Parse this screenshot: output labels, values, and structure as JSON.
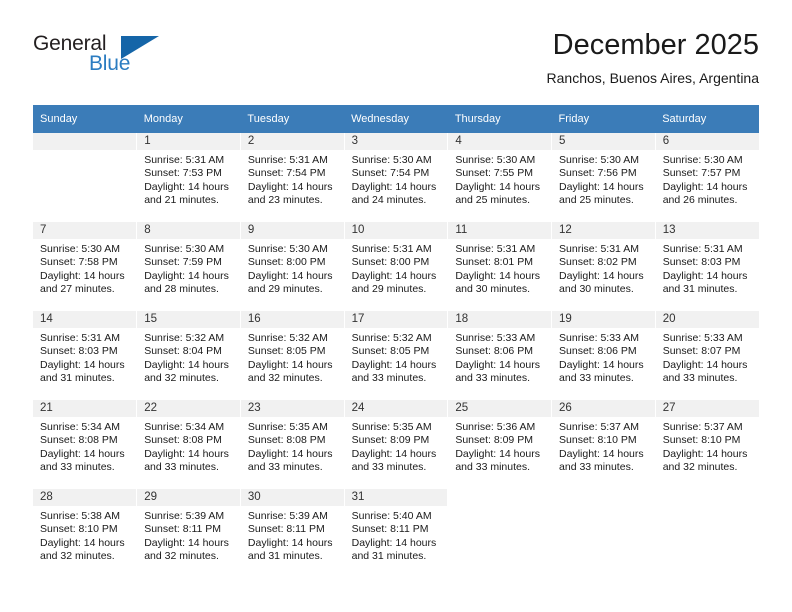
{
  "logo": {
    "line1": "General",
    "line2": "Blue",
    "triangle_color": "#1565a8",
    "blue_color": "#2b7cc1",
    "dark_color": "#231f20"
  },
  "header": {
    "title": "December 2025",
    "location": "Ranchos, Buenos Aires, Argentina"
  },
  "theme": {
    "header_bg": "#3b7cb8",
    "daynum_bg": "#f1f1f1",
    "text": "#1a1a1a"
  },
  "weekdays": [
    "Sunday",
    "Monday",
    "Tuesday",
    "Wednesday",
    "Thursday",
    "Friday",
    "Saturday"
  ],
  "labels": {
    "sunrise_prefix": "Sunrise:",
    "sunset_prefix": "Sunset:",
    "daylight_prefix": "Daylight:"
  },
  "weeks": [
    [
      {
        "day": "",
        "sunrise": "",
        "sunset": "",
        "daylight1": "",
        "daylight2": ""
      },
      {
        "day": "1",
        "sunrise": "Sunrise: 5:31 AM",
        "sunset": "Sunset: 7:53 PM",
        "daylight1": "Daylight: 14 hours",
        "daylight2": "and 21 minutes."
      },
      {
        "day": "2",
        "sunrise": "Sunrise: 5:31 AM",
        "sunset": "Sunset: 7:54 PM",
        "daylight1": "Daylight: 14 hours",
        "daylight2": "and 23 minutes."
      },
      {
        "day": "3",
        "sunrise": "Sunrise: 5:30 AM",
        "sunset": "Sunset: 7:54 PM",
        "daylight1": "Daylight: 14 hours",
        "daylight2": "and 24 minutes."
      },
      {
        "day": "4",
        "sunrise": "Sunrise: 5:30 AM",
        "sunset": "Sunset: 7:55 PM",
        "daylight1": "Daylight: 14 hours",
        "daylight2": "and 25 minutes."
      },
      {
        "day": "5",
        "sunrise": "Sunrise: 5:30 AM",
        "sunset": "Sunset: 7:56 PM",
        "daylight1": "Daylight: 14 hours",
        "daylight2": "and 25 minutes."
      },
      {
        "day": "6",
        "sunrise": "Sunrise: 5:30 AM",
        "sunset": "Sunset: 7:57 PM",
        "daylight1": "Daylight: 14 hours",
        "daylight2": "and 26 minutes."
      }
    ],
    [
      {
        "day": "7",
        "sunrise": "Sunrise: 5:30 AM",
        "sunset": "Sunset: 7:58 PM",
        "daylight1": "Daylight: 14 hours",
        "daylight2": "and 27 minutes."
      },
      {
        "day": "8",
        "sunrise": "Sunrise: 5:30 AM",
        "sunset": "Sunset: 7:59 PM",
        "daylight1": "Daylight: 14 hours",
        "daylight2": "and 28 minutes."
      },
      {
        "day": "9",
        "sunrise": "Sunrise: 5:30 AM",
        "sunset": "Sunset: 8:00 PM",
        "daylight1": "Daylight: 14 hours",
        "daylight2": "and 29 minutes."
      },
      {
        "day": "10",
        "sunrise": "Sunrise: 5:31 AM",
        "sunset": "Sunset: 8:00 PM",
        "daylight1": "Daylight: 14 hours",
        "daylight2": "and 29 minutes."
      },
      {
        "day": "11",
        "sunrise": "Sunrise: 5:31 AM",
        "sunset": "Sunset: 8:01 PM",
        "daylight1": "Daylight: 14 hours",
        "daylight2": "and 30 minutes."
      },
      {
        "day": "12",
        "sunrise": "Sunrise: 5:31 AM",
        "sunset": "Sunset: 8:02 PM",
        "daylight1": "Daylight: 14 hours",
        "daylight2": "and 30 minutes."
      },
      {
        "day": "13",
        "sunrise": "Sunrise: 5:31 AM",
        "sunset": "Sunset: 8:03 PM",
        "daylight1": "Daylight: 14 hours",
        "daylight2": "and 31 minutes."
      }
    ],
    [
      {
        "day": "14",
        "sunrise": "Sunrise: 5:31 AM",
        "sunset": "Sunset: 8:03 PM",
        "daylight1": "Daylight: 14 hours",
        "daylight2": "and 31 minutes."
      },
      {
        "day": "15",
        "sunrise": "Sunrise: 5:32 AM",
        "sunset": "Sunset: 8:04 PM",
        "daylight1": "Daylight: 14 hours",
        "daylight2": "and 32 minutes."
      },
      {
        "day": "16",
        "sunrise": "Sunrise: 5:32 AM",
        "sunset": "Sunset: 8:05 PM",
        "daylight1": "Daylight: 14 hours",
        "daylight2": "and 32 minutes."
      },
      {
        "day": "17",
        "sunrise": "Sunrise: 5:32 AM",
        "sunset": "Sunset: 8:05 PM",
        "daylight1": "Daylight: 14 hours",
        "daylight2": "and 33 minutes."
      },
      {
        "day": "18",
        "sunrise": "Sunrise: 5:33 AM",
        "sunset": "Sunset: 8:06 PM",
        "daylight1": "Daylight: 14 hours",
        "daylight2": "and 33 minutes."
      },
      {
        "day": "19",
        "sunrise": "Sunrise: 5:33 AM",
        "sunset": "Sunset: 8:06 PM",
        "daylight1": "Daylight: 14 hours",
        "daylight2": "and 33 minutes."
      },
      {
        "day": "20",
        "sunrise": "Sunrise: 5:33 AM",
        "sunset": "Sunset: 8:07 PM",
        "daylight1": "Daylight: 14 hours",
        "daylight2": "and 33 minutes."
      }
    ],
    [
      {
        "day": "21",
        "sunrise": "Sunrise: 5:34 AM",
        "sunset": "Sunset: 8:08 PM",
        "daylight1": "Daylight: 14 hours",
        "daylight2": "and 33 minutes."
      },
      {
        "day": "22",
        "sunrise": "Sunrise: 5:34 AM",
        "sunset": "Sunset: 8:08 PM",
        "daylight1": "Daylight: 14 hours",
        "daylight2": "and 33 minutes."
      },
      {
        "day": "23",
        "sunrise": "Sunrise: 5:35 AM",
        "sunset": "Sunset: 8:08 PM",
        "daylight1": "Daylight: 14 hours",
        "daylight2": "and 33 minutes."
      },
      {
        "day": "24",
        "sunrise": "Sunrise: 5:35 AM",
        "sunset": "Sunset: 8:09 PM",
        "daylight1": "Daylight: 14 hours",
        "daylight2": "and 33 minutes."
      },
      {
        "day": "25",
        "sunrise": "Sunrise: 5:36 AM",
        "sunset": "Sunset: 8:09 PM",
        "daylight1": "Daylight: 14 hours",
        "daylight2": "and 33 minutes."
      },
      {
        "day": "26",
        "sunrise": "Sunrise: 5:37 AM",
        "sunset": "Sunset: 8:10 PM",
        "daylight1": "Daylight: 14 hours",
        "daylight2": "and 33 minutes."
      },
      {
        "day": "27",
        "sunrise": "Sunrise: 5:37 AM",
        "sunset": "Sunset: 8:10 PM",
        "daylight1": "Daylight: 14 hours",
        "daylight2": "and 32 minutes."
      }
    ],
    [
      {
        "day": "28",
        "sunrise": "Sunrise: 5:38 AM",
        "sunset": "Sunset: 8:10 PM",
        "daylight1": "Daylight: 14 hours",
        "daylight2": "and 32 minutes."
      },
      {
        "day": "29",
        "sunrise": "Sunrise: 5:39 AM",
        "sunset": "Sunset: 8:11 PM",
        "daylight1": "Daylight: 14 hours",
        "daylight2": "and 32 minutes."
      },
      {
        "day": "30",
        "sunrise": "Sunrise: 5:39 AM",
        "sunset": "Sunset: 8:11 PM",
        "daylight1": "Daylight: 14 hours",
        "daylight2": "and 31 minutes."
      },
      {
        "day": "31",
        "sunrise": "Sunrise: 5:40 AM",
        "sunset": "Sunset: 8:11 PM",
        "daylight1": "Daylight: 14 hours",
        "daylight2": "and 31 minutes."
      },
      {
        "day": "",
        "sunrise": "",
        "sunset": "",
        "daylight1": "",
        "daylight2": ""
      },
      {
        "day": "",
        "sunrise": "",
        "sunset": "",
        "daylight1": "",
        "daylight2": ""
      },
      {
        "day": "",
        "sunrise": "",
        "sunset": "",
        "daylight1": "",
        "daylight2": ""
      }
    ]
  ]
}
